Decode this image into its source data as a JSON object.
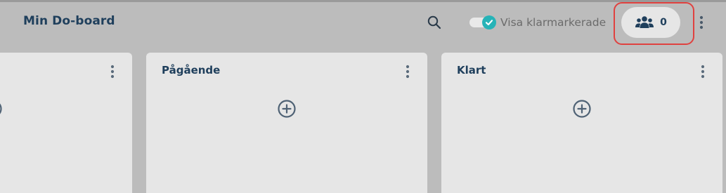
{
  "header": {
    "board_title": "Min Do-board",
    "search_icon": "search-icon",
    "show_completed_label": "Visa klarmarkerade",
    "show_completed_enabled": true,
    "members_count": "0",
    "members_icon": "users-icon",
    "more_icon": "more-vertical-icon"
  },
  "columns": [
    {
      "title": ""
    },
    {
      "title": "Pågående"
    },
    {
      "title": "Klart"
    }
  ],
  "colors": {
    "background": "#bcbcbc",
    "column": "#e6e6e6",
    "title_text": "#1f3f5c",
    "toggle_accent": "#26b3b7",
    "highlight": "#e0413f"
  }
}
